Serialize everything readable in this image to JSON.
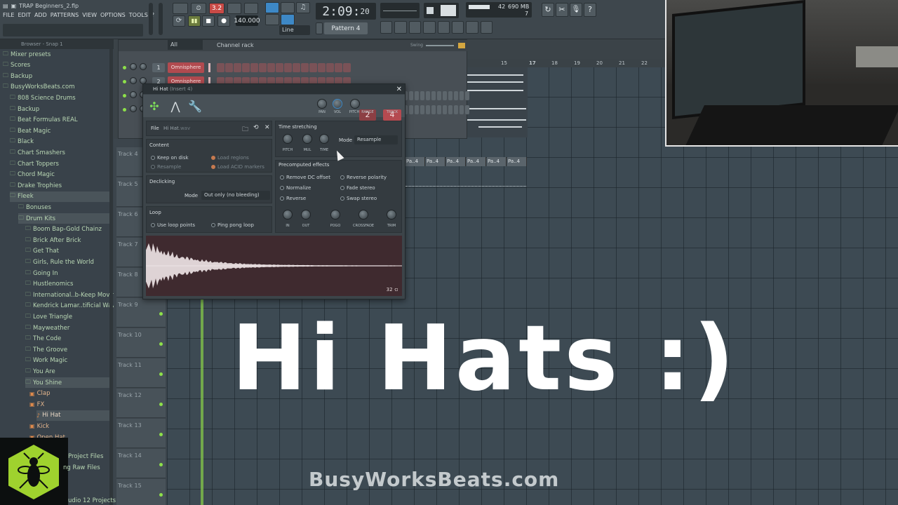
{
  "app": {
    "title": "TRAP Beginners_2.flp",
    "menu": [
      "FILE",
      "EDIT",
      "ADD",
      "PATTERNS",
      "VIEW",
      "OPTIONS",
      "TOOLS",
      "?"
    ],
    "tempo": "140.000",
    "time": "2:09",
    "time_ticks": "20",
    "time_unit": "B:S:T",
    "record_indicator": "3.2",
    "cpu_value": "42",
    "ram_value": "690 MB",
    "poly_value": "7",
    "snap": "Line",
    "pattern": "Pattern 4",
    "colors": {
      "accent_green": "#8de04a",
      "channel_red": "#b14a4f",
      "logo_green": "#9fd22e"
    }
  },
  "browser": {
    "header": "Browser - Snap 1",
    "items": [
      {
        "label": "Mixer presets",
        "kind": "folder",
        "indent": 0
      },
      {
        "label": "Scores",
        "kind": "folder",
        "indent": 0
      },
      {
        "label": "Backup",
        "kind": "folder",
        "indent": 0
      },
      {
        "label": "BusyWorksBeats.com",
        "kind": "folder",
        "indent": 0
      },
      {
        "label": "808 Science Drums",
        "kind": "folder",
        "indent": 1
      },
      {
        "label": "Backup",
        "kind": "folder",
        "indent": 1
      },
      {
        "label": "Beat Formulas REAL",
        "kind": "folder",
        "indent": 1
      },
      {
        "label": "Beat Magic",
        "kind": "folder",
        "indent": 1
      },
      {
        "label": "Black",
        "kind": "folder",
        "indent": 1
      },
      {
        "label": "Chart Smashers",
        "kind": "folder",
        "indent": 1
      },
      {
        "label": "Chart Toppers",
        "kind": "folder",
        "indent": 1
      },
      {
        "label": "Chord Magic",
        "kind": "folder",
        "indent": 1
      },
      {
        "label": "Drake Trophies",
        "kind": "folder",
        "indent": 1
      },
      {
        "label": "Fleek",
        "kind": "folder",
        "indent": 1,
        "selected": true
      },
      {
        "label": "Bonuses",
        "kind": "folder",
        "indent": 2
      },
      {
        "label": "Drum Kits",
        "kind": "folder",
        "indent": 2,
        "selected": true
      },
      {
        "label": "Boom Bap-Gold Chainz",
        "kind": "folder",
        "indent": 3
      },
      {
        "label": "Brick After Brick",
        "kind": "folder",
        "indent": 3
      },
      {
        "label": "Get That",
        "kind": "folder",
        "indent": 3
      },
      {
        "label": "Girls, Rule the World",
        "kind": "folder",
        "indent": 3
      },
      {
        "label": "Going In",
        "kind": "folder",
        "indent": 3
      },
      {
        "label": "Hustlenomics",
        "kind": "folder",
        "indent": 3
      },
      {
        "label": "International..b-Keep Moving",
        "kind": "folder",
        "indent": 3
      },
      {
        "label": "Kendrick Lamar..tificial Waves",
        "kind": "folder",
        "indent": 3
      },
      {
        "label": "Love Triangle",
        "kind": "folder",
        "indent": 3
      },
      {
        "label": "Mayweather",
        "kind": "folder",
        "indent": 3
      },
      {
        "label": "The Code",
        "kind": "folder",
        "indent": 3
      },
      {
        "label": "The Groove",
        "kind": "folder",
        "indent": 3
      },
      {
        "label": "Work Magic",
        "kind": "folder",
        "indent": 3
      },
      {
        "label": "You Are",
        "kind": "folder",
        "indent": 3
      },
      {
        "label": "You Shine",
        "kind": "folder",
        "indent": 3,
        "selected": true
      },
      {
        "label": "Clap",
        "kind": "file",
        "indent": 4
      },
      {
        "label": "FX",
        "kind": "file",
        "indent": 4
      },
      {
        "label": "Hi Hat",
        "kind": "wav",
        "indent": 5,
        "selected": true
      },
      {
        "label": "Kick",
        "kind": "file",
        "indent": 4
      },
      {
        "label": "Open Hat",
        "kind": "file",
        "indent": 4
      }
    ],
    "below_logo": [
      "Project Files",
      "ng Raw Files",
      "udio 12 Projects"
    ]
  },
  "channel_rack": {
    "title": "Channel rack",
    "filter": "All",
    "swing_label": "Swing",
    "channels": [
      {
        "num": "1",
        "name": "Omnisphere"
      },
      {
        "num": "2",
        "name": "Omnisphere #2"
      },
      {
        "num": "3",
        "name": ""
      },
      {
        "num": "4",
        "name": ""
      }
    ]
  },
  "playlist": {
    "ruler": [
      "15",
      "17",
      "18",
      "19",
      "20",
      "21",
      "22"
    ],
    "tracks": [
      "Track 4",
      "Track 5",
      "Track 6",
      "Track 7",
      "Track 8",
      "Track 9",
      "Track 10",
      "Track 11",
      "Track 12",
      "Track 13",
      "Track 14",
      "Track 15"
    ],
    "pattern_block_label": "Pa..4"
  },
  "plugin": {
    "title": "Hi Hat",
    "insert": "(Insert 4)",
    "pitch_range": "2",
    "track": "4",
    "knob_labels_top": [
      "PAN",
      "VOL",
      "PITCH",
      "RANGE",
      "TRACK"
    ],
    "file_label": "File",
    "file_name": "Hi Hat",
    "file_ext": ".wav",
    "content_label": "Content",
    "keep_on_disk": "Keep on disk",
    "resample": "Resample",
    "load_regions": "Load regions",
    "load_acid": "Load ACID markers",
    "declicking_label": "Declicking",
    "mode_label": "Mode",
    "declick_mode": "Out only (no bleeding)",
    "loop_label": "Loop",
    "use_loop_points": "Use loop points",
    "ping_pong": "Ping pong loop",
    "time_stretching": "Time stretching",
    "ts_mode_label": "Mode",
    "ts_mode": "Resample",
    "ts_knobs": [
      "PITCH",
      "MUL",
      "TIME"
    ],
    "precomputed": "Precomputed effects",
    "effects": [
      "Remove DC offset",
      "Reverse polarity",
      "Normalize",
      "Fade stereo",
      "Reverse",
      "Swap stereo"
    ],
    "bottom_knobs": [
      "IN",
      "OUT",
      "POGO",
      "CROSSFADE",
      "TRIM"
    ],
    "sample_counter": "32"
  },
  "overlay": {
    "headline": "Hi Hats :)",
    "watermark": "BusyWorksBeats.com"
  }
}
